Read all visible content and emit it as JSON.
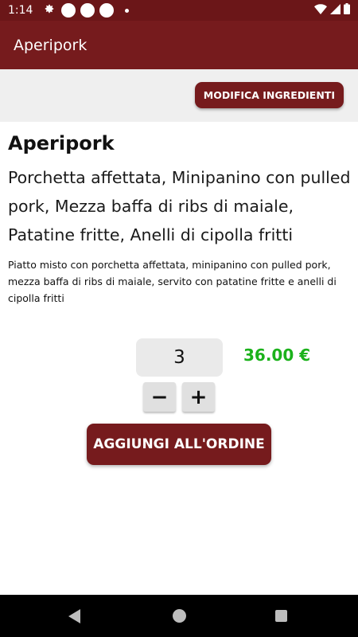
{
  "status_bar": {
    "time": "1:14",
    "icons": [
      "gear-icon",
      "circle-icon",
      "circle-icon",
      "circle-icon",
      "dot-icon",
      "wifi-icon",
      "signal-icon",
      "battery-icon"
    ]
  },
  "app_bar": {
    "title": "Aperipork"
  },
  "toolbar": {
    "modifica_label": "MODIFICA INGREDIENTI"
  },
  "product": {
    "title": "Aperipork",
    "ingredients": "Porchetta affettata, Minipanino con pulled pork, Mezza baffa di ribs di maiale, Patatine fritte, Anelli di cipolla fritti",
    "description": "Piatto misto con porchetta affettata, minipanino con pulled pork, mezza baffa di ribs di maiale, servito con patatine fritte e anelli di cipolla fritti"
  },
  "order": {
    "quantity": "3",
    "price": "36.00 €",
    "minus_label": "−",
    "plus_label": "+",
    "add_label": "AGGIUNGI ALL'ORDINE"
  },
  "colors": {
    "brand": "#761b1d",
    "price_green": "#1bb21b"
  }
}
